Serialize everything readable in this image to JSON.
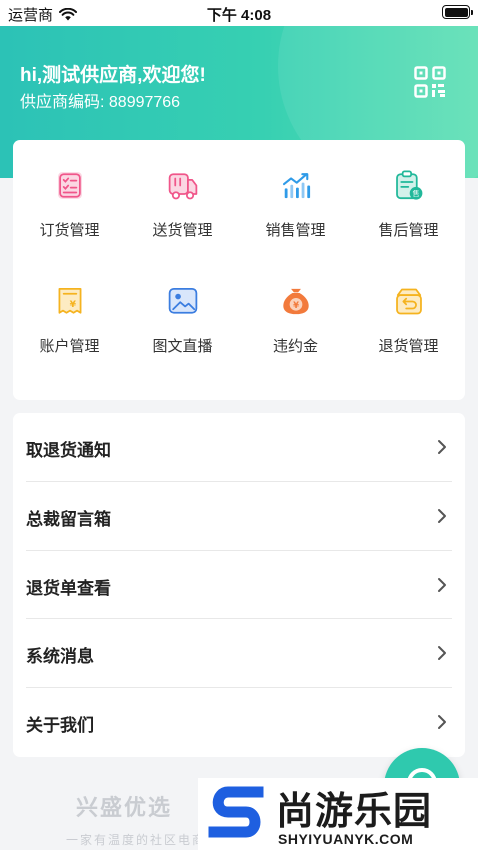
{
  "status_bar": {
    "carrier": "运营商",
    "time": "下午 4:08"
  },
  "header": {
    "greeting": "hi,测试供应商,欢迎您!",
    "supplier_code": "供应商编码: 88997766"
  },
  "grid": [
    {
      "label": "订货管理",
      "icon": "order-clipboard-icon",
      "color": "#f0568a"
    },
    {
      "label": "送货管理",
      "icon": "delivery-truck-icon",
      "color": "#f0568a"
    },
    {
      "label": "销售管理",
      "icon": "sales-chart-icon",
      "color": "#2f9be8"
    },
    {
      "label": "售后管理",
      "icon": "after-sales-clipboard-icon",
      "color": "#21b89a"
    },
    {
      "label": "账户管理",
      "icon": "account-receipt-icon",
      "color": "#f5b31f"
    },
    {
      "label": "图文直播",
      "icon": "image-live-icon",
      "color": "#3b7de0"
    },
    {
      "label": "违约金",
      "icon": "money-bag-icon",
      "color": "#f27a3c"
    },
    {
      "label": "退货管理",
      "icon": "return-box-icon",
      "color": "#f5b31f"
    }
  ],
  "list": [
    {
      "label": "取退货通知"
    },
    {
      "label": "总裁留言箱"
    },
    {
      "label": "退货单查看"
    },
    {
      "label": "系统消息"
    },
    {
      "label": "关于我们"
    }
  ],
  "footer": {
    "brand": "兴盛优选",
    "slogan": "一家有温度的社区电商"
  },
  "watermark": {
    "title": "尚游乐园",
    "url": "SHYIYUANYK.COM"
  },
  "colors": {
    "accent": "#2fc9ae",
    "header_start": "#2cc2b6",
    "header_end": "#5fe0b5"
  }
}
